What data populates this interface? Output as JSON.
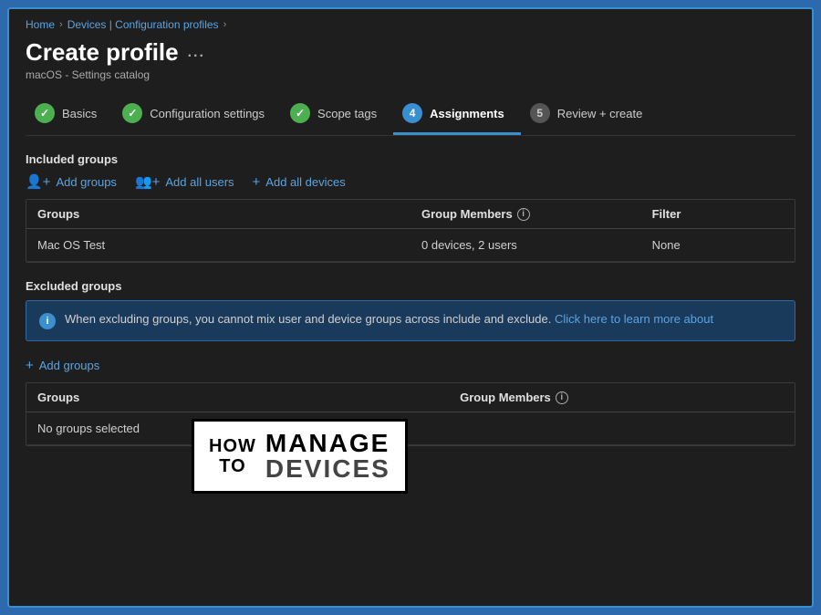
{
  "breadcrumb": {
    "home": "Home",
    "sep1": ">",
    "middle": "Devices | Configuration profiles",
    "sep2": ">"
  },
  "page": {
    "title": "Create profile",
    "ellipsis": "...",
    "subtitle": "macOS - Settings catalog"
  },
  "wizard": {
    "steps": [
      {
        "id": "basics",
        "label": "Basics",
        "icon_type": "complete",
        "icon_text": "✓",
        "active": false
      },
      {
        "id": "config",
        "label": "Configuration settings",
        "icon_type": "complete",
        "icon_text": "✓",
        "active": false
      },
      {
        "id": "scope",
        "label": "Scope tags",
        "icon_type": "complete",
        "icon_text": "✓",
        "active": false
      },
      {
        "id": "assignments",
        "label": "Assignments",
        "icon_type": "number",
        "icon_text": "4",
        "active": true
      },
      {
        "id": "review",
        "label": "Review + create",
        "icon_type": "inactive",
        "icon_text": "5",
        "active": false
      }
    ]
  },
  "included_groups": {
    "section_label": "Included groups",
    "add_groups_label": "Add groups",
    "add_all_users_label": "Add all users",
    "add_all_devices_label": "Add all devices",
    "table": {
      "col_groups": "Groups",
      "col_members": "Group Members",
      "col_filter": "Filter",
      "rows": [
        {
          "group": "Mac OS Test",
          "members": "0 devices, 2 users",
          "filter": "None"
        }
      ]
    }
  },
  "excluded_groups": {
    "section_label": "Excluded groups",
    "info_text": "When excluding groups, you cannot mix user and device groups across include and exclude.",
    "info_link": "Click here to learn more about",
    "add_groups_label": "Add groups",
    "table": {
      "col_groups": "Groups",
      "col_members": "Group Members",
      "rows": [
        {
          "group": "No groups selected",
          "members": ""
        }
      ]
    }
  },
  "watermark": {
    "how": "HOW",
    "to": "TO",
    "manage": "MANAGE",
    "devices": "DEVICES"
  }
}
